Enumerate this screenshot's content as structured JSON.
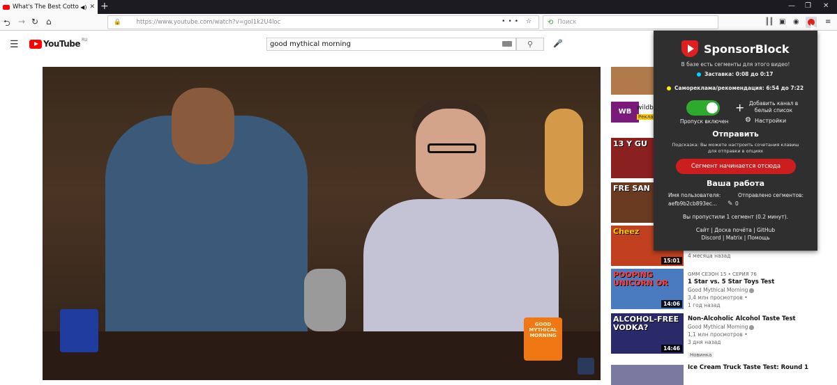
{
  "browser": {
    "tab_title": "What's The Best Cotton Can",
    "tab_sound_icon": "speaker-icon",
    "new_tab": "+",
    "url": "https://www.youtube.com/watch?v=gol1k2U4loc",
    "search_placeholder": "Поиск",
    "page_actions": "••• ☆"
  },
  "youtube": {
    "logo_text": "YouTube",
    "region": "RU",
    "search_query": "good mythical morning",
    "search_icon": "search-icon",
    "mic_icon": "mic-icon"
  },
  "video": {
    "mug_text": "GOOD MYTHICAL MORNING"
  },
  "ad": {
    "logo": "WB",
    "title": "wildb",
    "badge": "Рекла"
  },
  "recommendations": [
    {
      "thumb_text": "13 Y GU",
      "duration": "",
      "title": "",
      "channel": "",
      "views": "",
      "age": ""
    },
    {
      "thumb_text": "FRE SAN",
      "duration": "",
      "title": "",
      "channel": "",
      "views": "",
      "age": ""
    },
    {
      "thumb_text": "Cheez",
      "duration": "15:01",
      "title": "",
      "channel": "",
      "views": "",
      "age": "4 месяца назад"
    },
    {
      "thumb_text": "POOPING UNICORN OR",
      "duration": "14:06",
      "title": "1 Star vs. 5 Star Toys Test",
      "season": "GMM СЕЗОН 15 • СЕРИЯ 76",
      "channel": "Good Mythical Morning",
      "views": "3,4 млн просмотров •",
      "age": "1 год назад"
    },
    {
      "thumb_text": "ALCOHOL-FREE VODKA?",
      "duration": "14:46",
      "title": "Non-Alcoholic Alcohol Taste Test",
      "channel": "Good Mythical Morning",
      "views": "1,1 млн просмотров •",
      "age": "3 дня назад",
      "badge": "Новинка"
    },
    {
      "thumb_text": "",
      "duration": "",
      "title": "Ice Cream Truck Taste Test: Round 1",
      "channel": "",
      "views": "",
      "age": ""
    }
  ],
  "sponsorblock": {
    "name": "SponsorBlock",
    "has_segments": "В базе есть сегменты для этого видео!",
    "segment1": "Заставка: 0:08 до 0:17",
    "segment1_color": "#00d4ff",
    "segment2": "Самореклама/рекомендация: 6:54 до 7:22",
    "segment2_color": "#ffee00",
    "skip_enabled": "Пропуск включен",
    "whitelist": "Добавить канал в белый список",
    "settings": "Настройки",
    "submit_heading": "Отправить",
    "hint": "Подсказка: Вы можете настроить сочетания клавиш для отправки в опциях",
    "segment_start_button": "Сегмент начинается отсюда",
    "your_work": "Ваша работа",
    "username_label": "Имя пользователя:",
    "username": "aefb9b2cb893ec...",
    "submitted_label": "Отправлено сегментов:",
    "submitted_count": "0",
    "skipped_text": "Вы пропустили 1 сегмент (0.2 минут).",
    "links1": "Сайт | Доска почёта | GitHub",
    "links2": "Discord | Matrix | Помощь"
  }
}
